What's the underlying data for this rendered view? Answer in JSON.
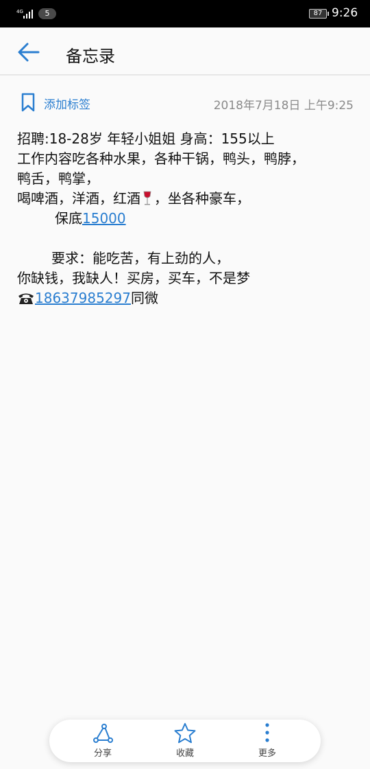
{
  "status_bar": {
    "network": "4G",
    "sim": "5",
    "battery": "87",
    "time": "9:26"
  },
  "header": {
    "title": "备忘录"
  },
  "meta": {
    "add_tag_label": "添加标签",
    "timestamp": "2018年7月18日 上午9:25"
  },
  "note": {
    "line1": "招聘:18-28岁 年轻小姐姐 身高：155以上",
    "line2": "工作内容吃各种水果，各种干锅，鸭头，鸭脖，",
    "line3": "鸭舌，鸭掌，",
    "line4_before": "喝啤酒，洋酒，红酒",
    "line4_after": "，坐各种豪车，",
    "line5_prefix": "保底",
    "line5_link": "15000",
    "line6": "要求：能吃苦，有上劲的人，",
    "line7": "你缺钱，我缺人！买房，买车，不是梦",
    "phone_link": "18637985297",
    "phone_suffix": "同微"
  },
  "toolbar": {
    "share_label": "分享",
    "favorite_label": "收藏",
    "more_label": "更多"
  },
  "colors": {
    "accent": "#2a7ed0",
    "status_bar_bg": "#000000",
    "background": "#fafafa"
  }
}
